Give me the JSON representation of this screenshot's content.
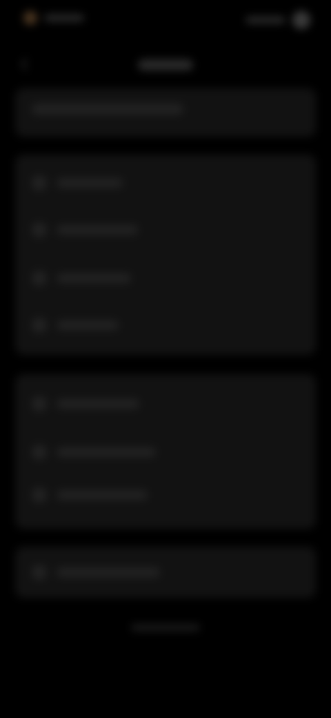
{
  "window": {
    "title": ""
  },
  "status_bar": {
    "left_icon": "orange-dot-icon",
    "right_icon": "circle-icon"
  },
  "navigation": {
    "back_icon": "chevron-left-icon",
    "title": ""
  },
  "sections": [
    {
      "id": "header",
      "rows": [
        {
          "label": "",
          "icon": ""
        }
      ]
    },
    {
      "id": "group-1",
      "rows": [
        {
          "label": "",
          "icon": "circle-icon"
        },
        {
          "label": "",
          "icon": "circle-icon"
        },
        {
          "label": "",
          "icon": "circle-icon"
        },
        {
          "label": "",
          "icon": "circle-icon"
        }
      ]
    },
    {
      "id": "group-2",
      "rows": [
        {
          "label": "",
          "icon": "circle-icon"
        },
        {
          "label": "",
          "icon": "circle-icon"
        },
        {
          "label": "",
          "icon": "circle-icon"
        }
      ]
    },
    {
      "id": "group-3",
      "rows": [
        {
          "label": "",
          "icon": "circle-icon"
        }
      ]
    }
  ],
  "colors": {
    "background": "#000000",
    "card": "#121212",
    "placeholder": "#222222",
    "accent": "#4a3520"
  }
}
